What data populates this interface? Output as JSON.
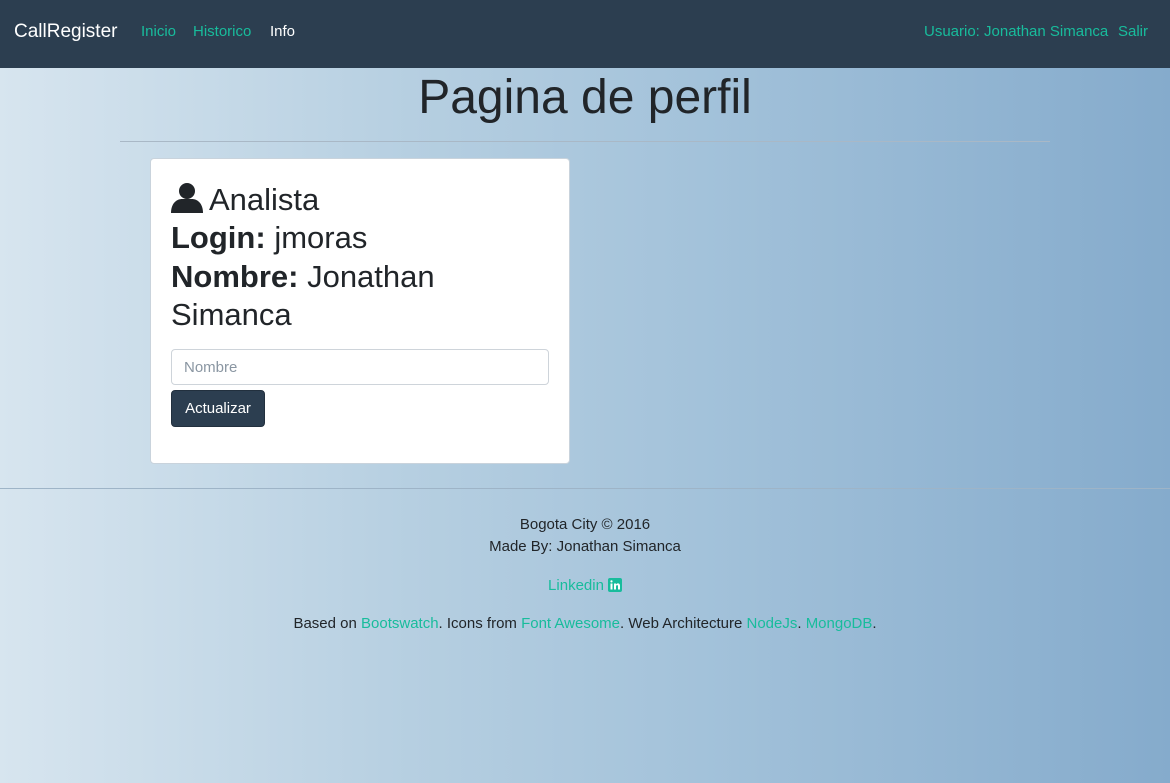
{
  "navbar": {
    "brand": "CallRegister",
    "links": [
      "Inicio",
      "Historico",
      "Info"
    ],
    "user_label": "Usuario: Jonathan Simanca",
    "logout_label": "Salir",
    "accent_color": "#18bc9c",
    "background_color": "#2c3e50"
  },
  "page": {
    "title": "Pagina de perfil"
  },
  "profile": {
    "icon": "user-icon",
    "role": "Analista",
    "login_label": "Login:",
    "login_value": "jmoras",
    "name_label": "Nombre:",
    "name_value_line1": "Jonathan",
    "name_value_line2": "Simanca",
    "name_input_placeholder": "Nombre",
    "name_input_value": "",
    "update_button": "Actualizar"
  },
  "footer": {
    "city_line": "Bogota City © 2016",
    "made_by": "Made By: Jonathan Simanca",
    "linkedin_label": "Linkedin",
    "linkedin_icon": "linkedin-icon",
    "based_on_prefix": "Based on ",
    "bootswatch": "Bootswatch",
    "icons_prefix": ". Icons from ",
    "font_awesome": "Font Awesome",
    "arch_prefix": ". Web Architecture ",
    "nodejs": "NodeJs",
    "sep": ". ",
    "mongodb": "MongoDB",
    "end": "."
  }
}
